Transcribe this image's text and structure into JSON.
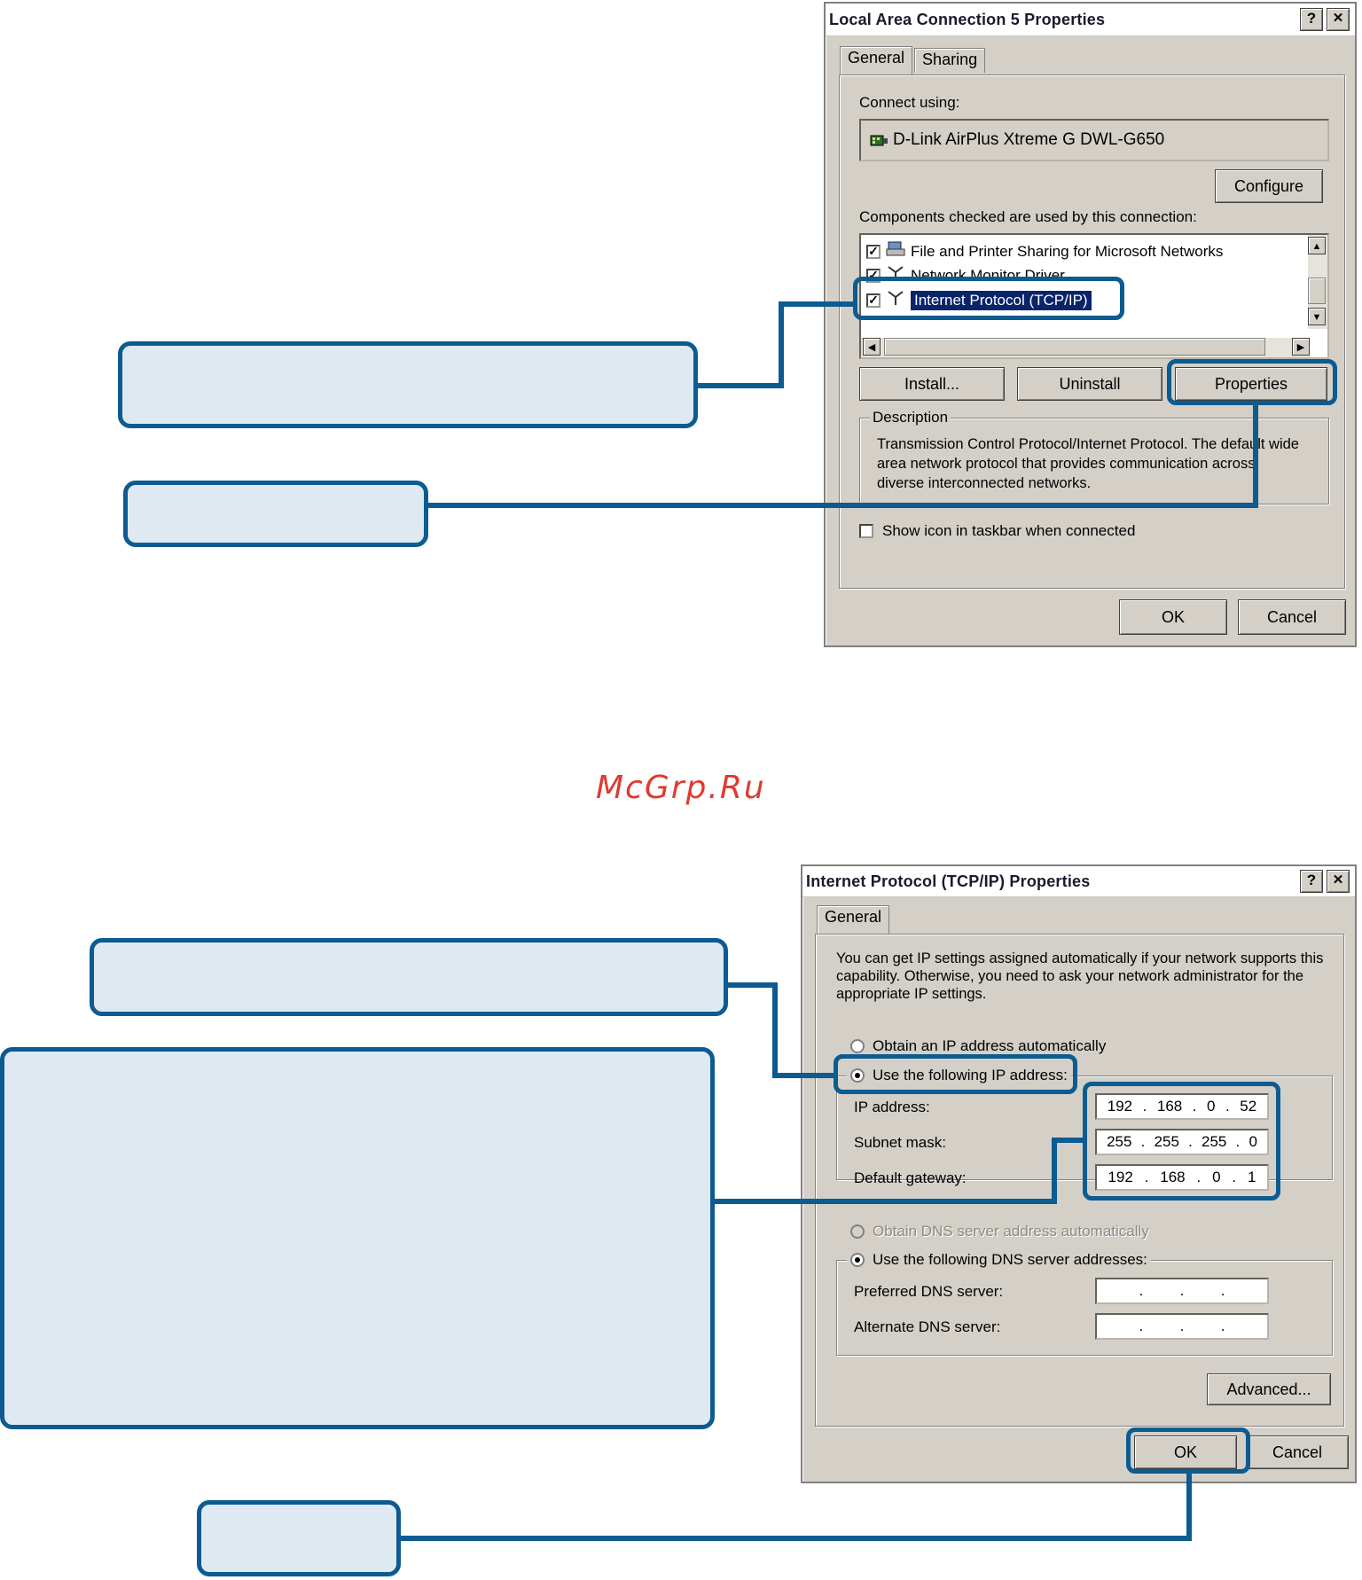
{
  "dialog1": {
    "title": "Local Area Connection 5 Properties",
    "help_button": "?",
    "close_button": "✕",
    "tabs": [
      "General",
      "Sharing"
    ],
    "connect_using_label": "Connect using:",
    "adapter_name": "D-Link AirPlus Xtreme G DWL-G650",
    "configure_button": "Configure",
    "components_label": "Components checked are used by this connection:",
    "components": [
      {
        "label": "File and Printer Sharing for Microsoft Networks",
        "checked": true
      },
      {
        "label": "Network Monitor Driver",
        "checked": true
      },
      {
        "label": "Internet Protocol (TCP/IP)",
        "checked": true,
        "selected": true
      }
    ],
    "install_button": "Install...",
    "uninstall_button": "Uninstall",
    "properties_button": "Properties",
    "description_legend": "Description",
    "description_text": "Transmission Control Protocol/Internet Protocol. The default wide area network protocol that provides communication across diverse interconnected networks.",
    "show_icon_label": "Show icon in taskbar when connected",
    "show_icon_checked": false,
    "ok_button": "OK",
    "cancel_button": "Cancel"
  },
  "watermark": "McGrp.Ru",
  "dialog2": {
    "title": "Internet Protocol (TCP/IP) Properties",
    "help_button": "?",
    "close_button": "✕",
    "tab": "General",
    "intro": "You can get IP settings assigned automatically if your network supports this capability. Otherwise, you need to ask your network administrator for the appropriate IP settings.",
    "obtain_ip_label": "Obtain an IP address automatically",
    "use_ip_label": "Use the following IP address:",
    "ip_label": "IP address:",
    "ip_value": [
      "192",
      "168",
      "0",
      "52"
    ],
    "subnet_label": "Subnet mask:",
    "subnet_value": [
      "255",
      "255",
      "255",
      "0"
    ],
    "gateway_label": "Default gateway:",
    "gateway_value": [
      "192",
      "168",
      "0",
      "1"
    ],
    "obtain_dns_label": "Obtain DNS server address automatically",
    "use_dns_label": "Use the following DNS server addresses:",
    "preferred_dns_label": "Preferred DNS server:",
    "alternate_dns_label": "Alternate DNS server:",
    "advanced_button": "Advanced...",
    "ok_button": "OK",
    "cancel_button": "Cancel"
  },
  "colors": {
    "callout_border": "#0c5b91",
    "callout_fill": "#dfe9f2",
    "dialog_bg": "#d4d0c8",
    "selection": "#0a246a",
    "watermark": "#e03a2e"
  }
}
